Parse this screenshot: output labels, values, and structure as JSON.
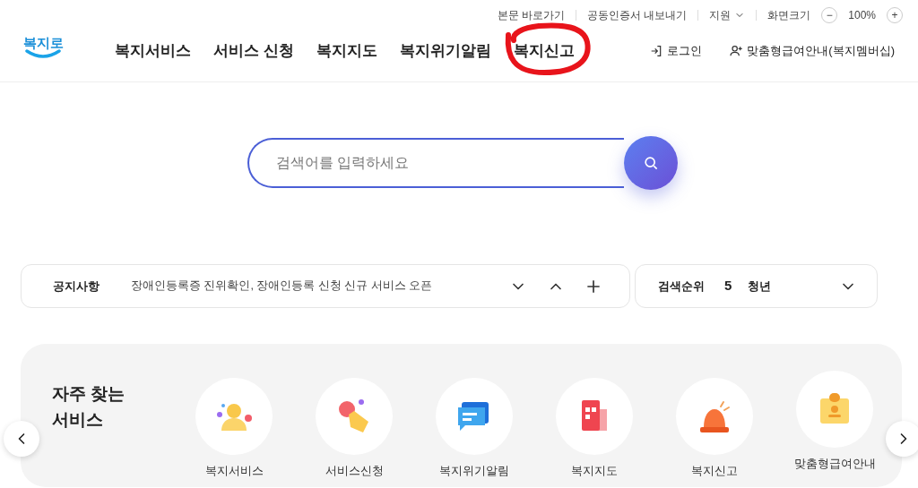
{
  "utility_links": [
    "본문 바로가기",
    "공동인증서 내보내기"
  ],
  "support": {
    "label": "지원"
  },
  "zoom": {
    "label": "화면크기",
    "minus": "−",
    "value": "100%",
    "plus": "+"
  },
  "logo": "복지로",
  "nav": [
    {
      "label": "복지서비스",
      "annotated": false
    },
    {
      "label": "서비스 신청",
      "annotated": false
    },
    {
      "label": "복지지도",
      "annotated": false
    },
    {
      "label": "복지위기알림",
      "annotated": false
    },
    {
      "label": "복지신고",
      "annotated": true
    }
  ],
  "account": {
    "login": "로그인",
    "membership": "맞춤형급여안내(복지멤버십)"
  },
  "search": {
    "placeholder": "검색어를 입력하세요"
  },
  "notice": {
    "label": "공지사항",
    "text": "장애인등록증 진위확인, 장애인등록 신청 신규 서비스 오픈"
  },
  "ranking": {
    "label": "검색순위",
    "rank": "5",
    "term": "청년"
  },
  "frequent": {
    "title": "자주 찾는\n서비스",
    "items": [
      {
        "kind": "person",
        "label": "복지서비스"
      },
      {
        "kind": "hand",
        "label": "서비스신청"
      },
      {
        "kind": "chat",
        "label": "복지위기알림"
      },
      {
        "kind": "building",
        "label": "복지지도"
      },
      {
        "kind": "siren",
        "label": "복지신고"
      },
      {
        "kind": "badge",
        "label": "맞춤형급여안내"
      }
    ]
  }
}
